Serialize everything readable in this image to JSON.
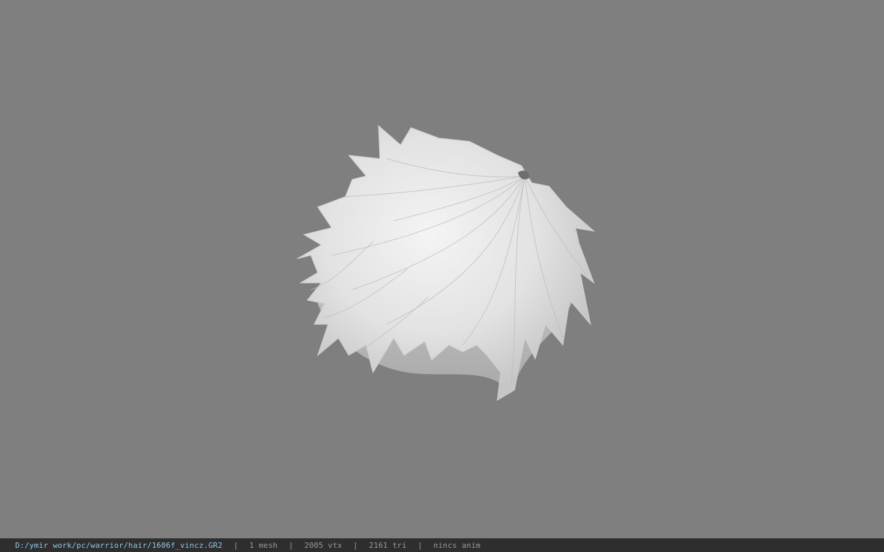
{
  "viewport": {
    "background": "#7f7f7f",
    "model_name": "hair mesh"
  },
  "statusbar": {
    "path": "D:/ymir work/pc/warrior/hair/1606f_vincz.GR2",
    "separator": "|",
    "mesh_count": "1 mesh",
    "vertex_count": "2005 vtx",
    "triangle_count": "2161 tri",
    "anim": "nincs anim",
    "path_color": "#8fc7e6",
    "text_color": "#9a9a9a"
  }
}
